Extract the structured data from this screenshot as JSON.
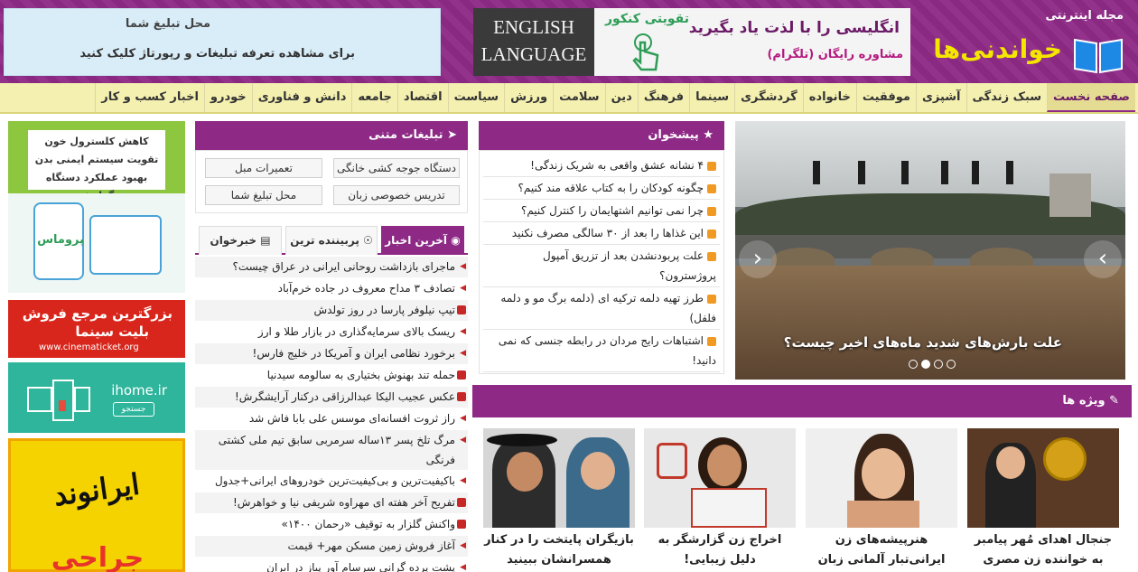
{
  "header": {
    "tagline": "مجله اینترنتی",
    "site_name": "خواندنی‌ها",
    "ad_english": {
      "chalk_text": "ENGLISH LANGUAGE",
      "green_text": "تقویتی کنکور",
      "line1": "انگلیسی را با لذت یاد بگیرید",
      "line2": "مشاوره رایگان (تلگرام)"
    },
    "ad_slot": {
      "title": "محل تبلیغ شما",
      "subtitle": "برای مشاهده تعرفه تبلیغات و رپورتاژ کلیک کنید"
    }
  },
  "nav": {
    "items": [
      "صفحه نخست",
      "سبک زندگی",
      "آشپزی",
      "موفقیت",
      "خانواده",
      "گردشگری",
      "سینما",
      "فرهنگ",
      "دین",
      "سلامت",
      "ورزش",
      "سیاست",
      "اقتصاد",
      "جامعه",
      "دانش و فناوری",
      "خودرو",
      "اخبار کسب و کار"
    ]
  },
  "slider": {
    "caption": "علت بارش‌های شدید ماه‌های اخیر چیست؟",
    "active_slide": 2,
    "slide_count": 4
  },
  "suggest": {
    "title": "پیشخوان",
    "items": [
      "۴ نشانه عشق واقعی به شریک زندگی!",
      "چگونه کودکان را به کتاب علاقه مند کنیم؟",
      "چرا نمی توانیم اشتهایمان را کنترل کنیم؟",
      "این غذاها را بعد از ۳۰ سالگی مصرف نکنید",
      "علت پربودنشدن بعد از تزریق آمپول پروژسترون؟",
      "طرز تهیه دلمه ترکیه ای (دلمه برگ مو و دلمه فلفل)",
      "اشتباهات رایج مردان در رابطه جنسی که نمی دانید!"
    ]
  },
  "text_ads": {
    "title": "تبلیغات متنی",
    "items": [
      "دستگاه جوجه کشی خانگی",
      "تعمیرات مبل",
      "تدریس خصوصی زبان",
      "محل تبلیغ شما"
    ]
  },
  "tabs": {
    "items": [
      "آخرین اخبار",
      "پربیننده ترین",
      "خبرخوان"
    ]
  },
  "news": {
    "items": [
      "ماجرای بازداشت روحانی ایرانی در عراق چیست؟",
      "تصادف ۳ مداح معروف در جاده خرم‌آباد",
      "تیپ نیلوفر پارسا در روز تولدش",
      "ریسک بالای سرمایه‌گذاری در بازار طلا و ارز",
      "برخورد نظامی ایران و آمریکا در خلیج فارس!",
      "حمله تند بهنوش بختیاری به سالومه سیدنیا",
      "عکس عجیب الیکا عبدالرزاقی درکنار آرایشگرش!",
      "راز ثروت افسانه‌ای موسس علی بابا فاش شد",
      "مرگ تلخ پسر ۱۳ساله سرمربی سابق تیم ملی کشتی فرنگی",
      "باکیفیت‌ترین و بی‌کیفیت‌ترین خودروهای ایرانی+جدول",
      "تفریح آخر هفته ای مهراوه شریفی نیا و خواهرش!",
      "واکنش گلزار به توقیف «رحمان ۱۴۰۰»",
      "آغاز فروش زمین مسکن مهر+ قیمت",
      "پشت پرده گرانی سرسام آور پیاز در ایران"
    ]
  },
  "left_ads": {
    "pharma": {
      "line1": "کاهش کلسترول خون",
      "line2": "تقویت سیستم ایمنی بدن",
      "line3": "بهبود عملکرد دستگاه گوارش",
      "brand": "پروماس"
    },
    "cinema": {
      "line1": "بزرگترین مرجع فروش",
      "line2": "بلیت سینما",
      "url": "www.cinematicket.org"
    },
    "ihome": {
      "brand": "ihome.ir",
      "button": "جستجو"
    },
    "iranvand": {
      "logo": "ایرانوند",
      "text": "جراحی"
    }
  },
  "features": {
    "title": "ویژه ها",
    "items": [
      "جنجال اهدای مُهر پیامبر به خواننده زن مصری",
      "هنرپیشه‌های زن ایرانی‌تبار آلمانی زبان",
      "اخراج زن گزارشگر به دلیل زیبایی!",
      "بازیگران پایتخت را در کنار همسرانشان ببینید"
    ]
  },
  "colors": {
    "brand_purple": "#8e2a86",
    "nav_bg": "#f4f0b0",
    "logo_yellow": "#f5e600",
    "accent_orange": "#f09a24",
    "news_marker_red": "#c62828"
  }
}
